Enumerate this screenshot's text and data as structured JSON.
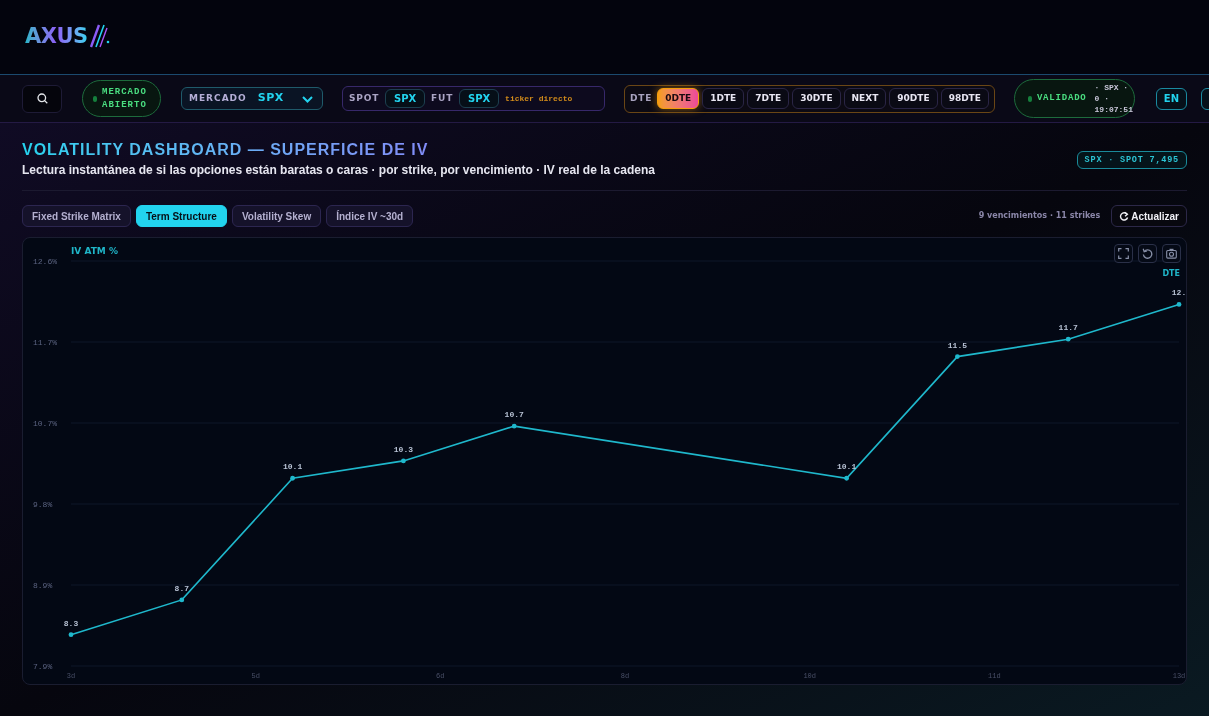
{
  "header": {
    "logo": "AXUS"
  },
  "nav": {
    "market_status": {
      "label": "MERCADO ABIERTO"
    },
    "market_select": {
      "label": "MERCADO",
      "value": "SPX"
    },
    "tickers": {
      "spot_label": "SPOT",
      "spot_value": "SPX",
      "fut_label": "FUT",
      "fut_value": "SPX",
      "note": "ticker directo"
    },
    "dte": {
      "label": "DTE",
      "options": [
        {
          "label": "0DTE",
          "selected": true
        },
        {
          "label": "1DTE",
          "selected": false
        },
        {
          "label": "7DTE",
          "selected": false
        },
        {
          "label": "30DTE",
          "selected": false
        },
        {
          "label": "NEXT",
          "selected": false
        },
        {
          "label": "90DTE",
          "selected": false
        },
        {
          "label": "98DTE",
          "selected": false
        }
      ]
    },
    "validation": {
      "label": "VALIDADO",
      "detail": "· SPX · 0 · 19:07:51"
    },
    "language": "EN"
  },
  "page": {
    "title": "VOLATILITY DASHBOARD — SUPERFICIE DE IV",
    "subtitle": "Lectura instantánea de si las opciones están baratas o caras · por strike, por vencimiento · IV real de la cadena",
    "badge": "SPX · SPOT 7,495"
  },
  "tabs": [
    {
      "label": "Fixed Strike Matrix",
      "selected": false
    },
    {
      "label": "Term Structure",
      "selected": true
    },
    {
      "label": "Volatility Skew",
      "selected": false
    },
    {
      "label": "Índice IV ~30d",
      "selected": false
    }
  ],
  "summary": "9 vencimientos · 11 strikes",
  "refresh_button": "Actualizar",
  "chart": {
    "chart_data": {
      "type": "line",
      "xlabel": "DTE",
      "ylabel": "IV ATM %",
      "x": [
        3,
        4,
        5,
        6,
        7,
        10,
        11,
        12,
        13
      ],
      "series": [
        {
          "color": "#1fb8cc",
          "values": [
            8.3,
            8.7,
            10.1,
            10.3,
            10.7,
            10.1,
            11.5,
            11.7,
            12.1
          ]
        }
      ],
      "xlim": [
        3,
        13
      ],
      "ylim": [
        7.94,
        12.6
      ],
      "xticks": [
        {
          "value": 3,
          "label": "3d"
        },
        {
          "value": 4.667,
          "label": "5d"
        },
        {
          "value": 6.333,
          "label": "6d"
        },
        {
          "value": 8,
          "label": "8d"
        },
        {
          "value": 9.667,
          "label": "10d"
        },
        {
          "value": 11.333,
          "label": "11d"
        },
        {
          "value": 13,
          "label": "13d"
        }
      ],
      "yticks": [
        {
          "value": 7.94,
          "label": "7.9%"
        },
        {
          "value": 8.872,
          "label": "8.9%"
        },
        {
          "value": 9.804,
          "label": "9.8%"
        },
        {
          "value": 10.736,
          "label": "10.7%"
        },
        {
          "value": 11.668,
          "label": "11.7%"
        },
        {
          "value": 12.6,
          "label": "12.6%"
        }
      ],
      "grid": true,
      "value_labels": [
        "8.3",
        "8.7",
        "10.1",
        "10.3",
        "10.7",
        "10.1",
        "11.5",
        "11.7",
        "12."
      ]
    }
  }
}
